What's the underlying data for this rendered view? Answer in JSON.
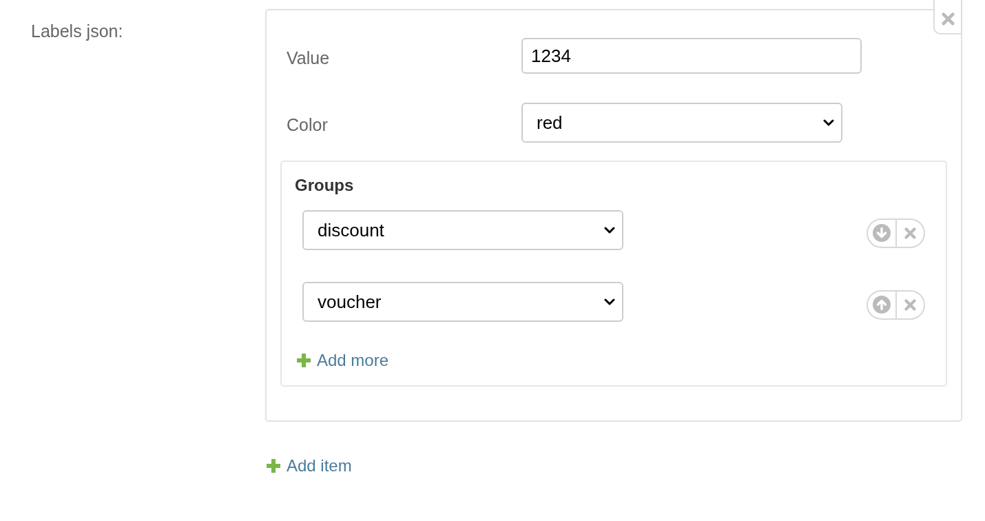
{
  "field": {
    "label": "Labels json:"
  },
  "items": [
    {
      "fields": [
        {
          "kind": "input",
          "label": "Value",
          "value": "1234"
        },
        {
          "kind": "select",
          "label": "Color",
          "value": "red"
        }
      ],
      "groups": {
        "title": "Groups",
        "entries": [
          {
            "value": "discount",
            "kind": "down"
          },
          {
            "value": "voucher",
            "kind": "up"
          }
        ],
        "add_label": "Add more"
      }
    }
  ],
  "add_label": "Add item"
}
